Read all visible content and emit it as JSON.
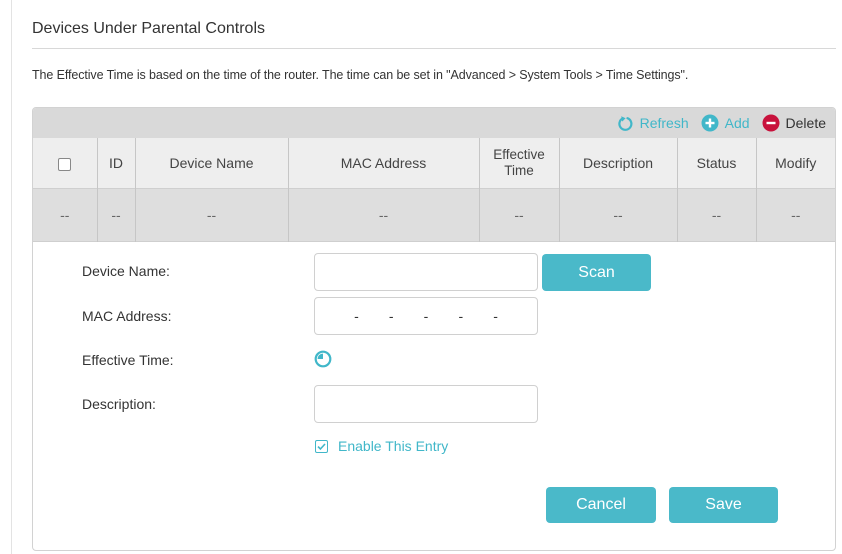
{
  "section": {
    "title": "Devices Under Parental Controls",
    "notice": "The Effective Time is based on the time of the router. The time can be set in \"Advanced > System Tools > Time Settings\"."
  },
  "toolbar": {
    "refresh_label": "Refresh",
    "add_label": "Add",
    "delete_label": "Delete"
  },
  "table": {
    "headers": {
      "id": "ID",
      "device_name": "Device Name",
      "mac_address": "MAC Address",
      "effective_time_line1": "Effective",
      "effective_time_line2": "Time",
      "description": "Description",
      "status": "Status",
      "modify": "Modify"
    },
    "rows": [
      {
        "id": "--",
        "device_name": "--",
        "mac_address": "--",
        "effective_time": "--",
        "description": "--",
        "status": "--",
        "modify": "--",
        "select": "--"
      }
    ]
  },
  "form": {
    "device_name_label": "Device Name:",
    "device_name_value": "",
    "scan_label": "Scan",
    "mac_address_label": "MAC Address:",
    "mac_separator": "-",
    "effective_time_label": "Effective Time:",
    "description_label": "Description:",
    "description_value": "",
    "enable_label": "Enable This Entry",
    "enable_checked": true,
    "cancel_label": "Cancel",
    "save_label": "Save"
  },
  "colors": {
    "accent": "#4ab9c9",
    "delete": "#c8123c",
    "header_bg": "#d9d9d9"
  }
}
